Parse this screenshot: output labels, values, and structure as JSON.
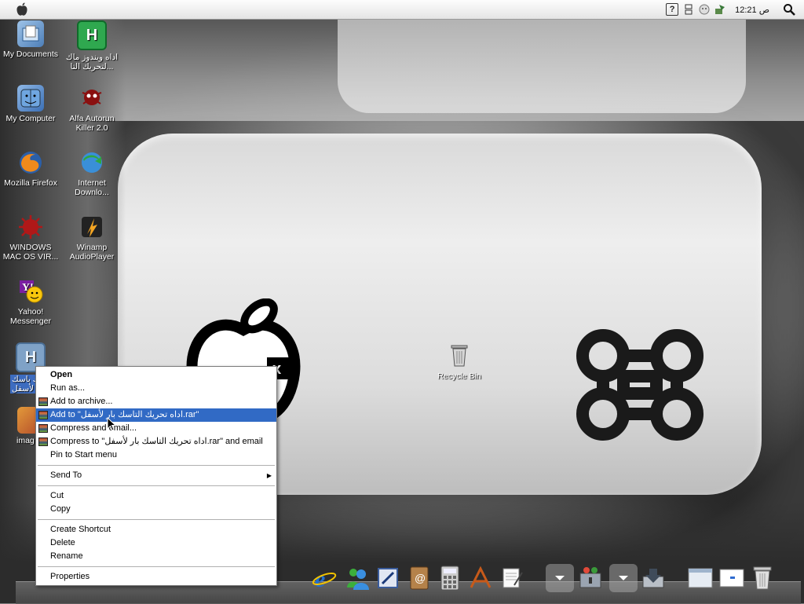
{
  "menubar": {
    "clock": "12:21 ص"
  },
  "desktop_icons": [
    {
      "label": "My Documents"
    },
    {
      "label": "اداه ويندوز ماك لتحريك التا..."
    },
    {
      "label": "My Computer"
    },
    {
      "label": "Alfa Autorun Killer 2.0"
    },
    {
      "label": "Mozilla Firefox"
    },
    {
      "label": "Internet Downlo..."
    },
    {
      "label": "WINDOWS MAC OS VIR..."
    },
    {
      "label": "Winamp AudioPlayer"
    },
    {
      "label": "Yahoo! Messenger"
    },
    {
      "label": "تحريك باسك بار لأسفل"
    },
    {
      "label": "imag"
    },
    {
      "label": "Recycle Bin"
    }
  ],
  "context_menu": {
    "items": [
      {
        "label": "Open"
      },
      {
        "label": "Run as..."
      },
      {
        "label": "Add to archive..."
      },
      {
        "label": "Add to \"اداه تحريك التاسك بار لأسفل.rar\""
      },
      {
        "label": "Compress and email..."
      },
      {
        "label": "Compress to \"اداه تحريك التاسك بار لأسفل.rar\" and email"
      },
      {
        "label": "Pin to Start menu"
      },
      {
        "label": "Send To"
      },
      {
        "label": "Cut"
      },
      {
        "label": "Copy"
      },
      {
        "label": "Create Shortcut"
      },
      {
        "label": "Delete"
      },
      {
        "label": "Rename"
      },
      {
        "label": "Properties"
      }
    ]
  },
  "colors": {
    "highlight": "#316ac5",
    "selection_label": "#3d6cc0"
  }
}
